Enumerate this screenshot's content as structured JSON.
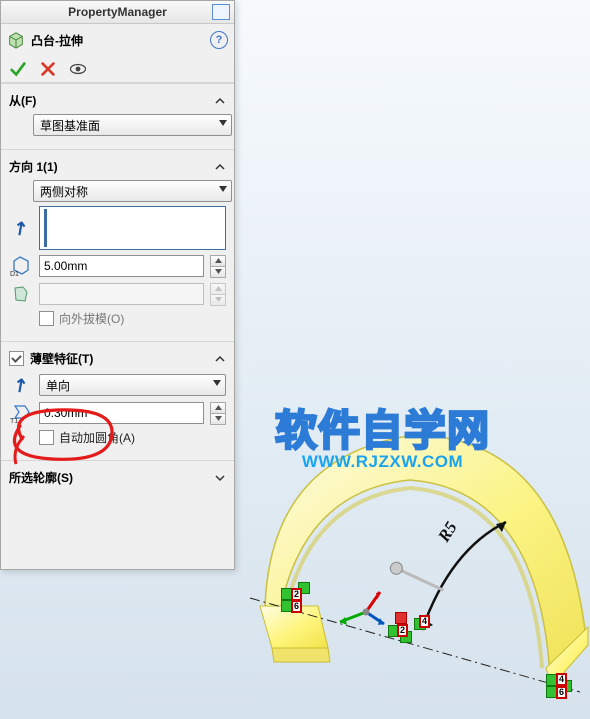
{
  "header": {
    "title": "PropertyManager"
  },
  "feature": {
    "name": "凸台-拉伸"
  },
  "actions": {
    "ok": "ok",
    "cancel": "cancel",
    "preview": "preview"
  },
  "from": {
    "label": "从(F)",
    "option": "草图基准面"
  },
  "direction1": {
    "label": "方向 1(1)",
    "end_condition": "两侧对称",
    "depth": "5.00mm",
    "selection": "",
    "draft_on": false,
    "draft_label": "向外拔模(O)"
  },
  "thin": {
    "label": "薄壁特征(T)",
    "enabled": true,
    "type": "单向",
    "thickness": "0.30mm",
    "auto_fillet_on": false,
    "auto_fillet_label": "自动加圆角(A)"
  },
  "contour": {
    "label": "所选轮廓(S)"
  },
  "watermark": {
    "big": "软件自学网",
    "small": "WWW.RJZXW.COM"
  },
  "sketch": {
    "radius_label": "R5",
    "tags": [
      "2",
      "6",
      "2",
      "4",
      "4",
      "6"
    ]
  }
}
